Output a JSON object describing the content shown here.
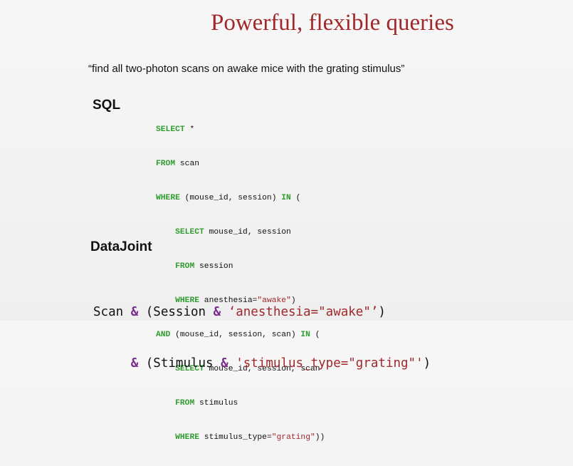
{
  "slide": {
    "title": "Powerful, flexible queries",
    "quote": "“find all two-photon scans on awake mice with the grating stimulus”",
    "sql_label": "SQL",
    "datajoint_label": "DataJoint"
  },
  "sql": {
    "l1_kw": "SELECT",
    "l1_rest": " *",
    "l2_kw": "FROM",
    "l2_rest": " scan",
    "l3_kw": "WHERE",
    "l3_mid": " (mouse_id, session) ",
    "l3_kw2": "IN",
    "l3_end": " (",
    "l4_indent": "    ",
    "l4_kw": "SELECT",
    "l4_rest": " mouse_id, session",
    "l5_indent": "    ",
    "l5_kw": "FROM",
    "l5_rest": " session",
    "l6_indent": "    ",
    "l6_kw": "WHERE",
    "l6_rest": " anesthesia=",
    "l6_str": "\"awake\"",
    "l6_end": ")",
    "l7_kw": "AND",
    "l7_mid": " (mouse_id, session, scan) ",
    "l7_kw2": "IN",
    "l7_end": " (",
    "l8_indent": "    ",
    "l8_kw": "SELECT",
    "l8_rest": " mouse_id, session, scan",
    "l9_indent": "    ",
    "l9_kw": "FROM",
    "l9_rest": " stimulus",
    "l10_indent": "    ",
    "l10_kw": "WHERE",
    "l10_rest": " stimulus_type=",
    "l10_str": "\"grating\"",
    "l10_end": "))"
  },
  "datajoint": {
    "l1_a": "Scan ",
    "l1_op": "&",
    "l1_b": " (Session ",
    "l1_op2": "&",
    "l1_c": " ",
    "l1_str": "‘anesthesia=\"awake\"’",
    "l1_end": ")",
    "l2_indent": "     ",
    "l2_op": "&",
    "l2_b": " (Stimulus ",
    "l2_op2": "&",
    "l2_c": " ",
    "l2_str": "'stimulus_type=\"grating\"'",
    "l2_end": ")"
  },
  "colors": {
    "title": "#a0282a",
    "keyword": "#2f9c2f",
    "string": "#a0282a",
    "operator": "#7a2c8c",
    "background": "#f3f3f3"
  }
}
